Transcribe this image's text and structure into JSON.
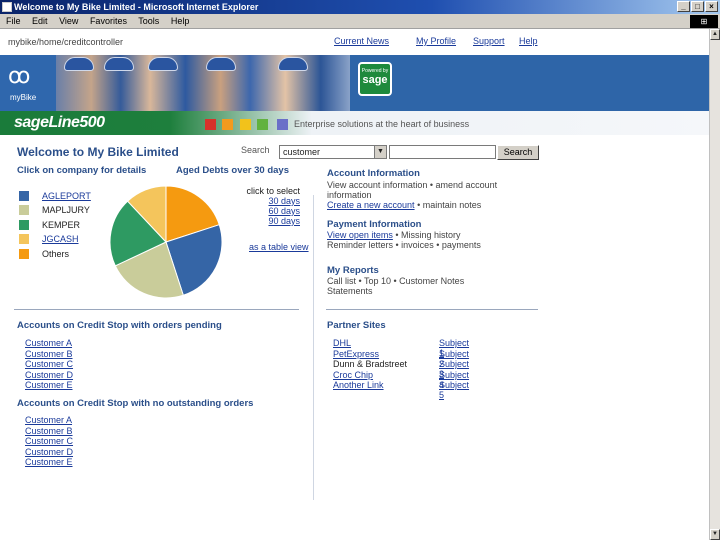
{
  "window": {
    "title": "Welcome to My Bike Limited - Microsoft Internet Explorer"
  },
  "menubar": [
    "File",
    "Edit",
    "View",
    "Favorites",
    "Tools",
    "Help"
  ],
  "breadcrumb": "mybike/home/creditcontroller",
  "toplinks": [
    "Current News",
    "My Profile",
    "Support",
    "Help"
  ],
  "banner": {
    "logo_label": "myBike",
    "powered_by": "Powered by",
    "sage_logo": "sage"
  },
  "brandbar": {
    "brand": "sageLine500",
    "tagline": "Enterprise solutions at the heart of business",
    "squares": [
      "#d7322a",
      "#f39a1e",
      "#f2c21b",
      "#62b23f",
      "#6a6fc8"
    ]
  },
  "welcome": "Welcome to My Bike Limited",
  "search": {
    "label": "Search",
    "selected": "customer",
    "button": "Search"
  },
  "left": {
    "click_heading": "Click on company for details",
    "aged_heading": "Aged Debts over 30 days",
    "companies": [
      {
        "name": "AGLEPORT",
        "color": "#3565a6",
        "link": true
      },
      {
        "name": "MAPLJURY",
        "color": "#c9cc9a",
        "link": false
      },
      {
        "name": "KEMPER",
        "color": "#2e9a62",
        "link": false
      },
      {
        "name": "JGCASH",
        "color": "#f4c55c",
        "link": true
      },
      {
        "name": "Others",
        "color": "#f59a10",
        "link": false
      }
    ],
    "pie_slices": [
      {
        "color": "#f59a10",
        "value": 20
      },
      {
        "color": "#3565a6",
        "value": 25
      },
      {
        "color": "#c9cc9a",
        "value": 23
      },
      {
        "color": "#2e9a62",
        "value": 20
      },
      {
        "color": "#f4c55c",
        "value": 12
      }
    ],
    "click_select": "click to select",
    "day_links": [
      "30 days",
      "60 days",
      "90 days"
    ],
    "tabular_link": "as a table view",
    "credit_stop_pending": {
      "heading": "Accounts on Credit Stop with orders pending",
      "items": [
        "Customer A",
        "Customer B",
        "Customer C",
        "Customer D",
        "Customer E"
      ]
    },
    "credit_stop_none": {
      "heading": "Accounts on Credit Stop with no outstanding orders",
      "items": [
        "Customer A",
        "Customer B",
        "Customer C",
        "Customer D",
        "Customer E"
      ]
    }
  },
  "right": {
    "account_info": {
      "heading": "Account Information",
      "line1": "View account information • amend account",
      "line2": "information",
      "link": "Create a new account",
      "link_suffix": " • maintain notes"
    },
    "payment_info": {
      "heading": "Payment Information",
      "link": "View open items",
      "link_suffix": " • Missing history",
      "line2": "Reminder letters • invoices • payments"
    },
    "reports": {
      "heading": "My Reports",
      "line1": "Call list • Top 10 • Customer Notes",
      "line2": "Statements"
    },
    "partners": {
      "heading": "Partner Sites",
      "rows": [
        {
          "name": "DHL",
          "link": "Subject 1"
        },
        {
          "name": "PetExpress",
          "link": "Subject 2"
        },
        {
          "name": "Dunn & Bradstreet",
          "link": "Subject 3"
        },
        {
          "name": "Croc Chip",
          "link": "Subject 4"
        },
        {
          "name": "Another Link",
          "link": "Subject 5"
        }
      ]
    }
  }
}
